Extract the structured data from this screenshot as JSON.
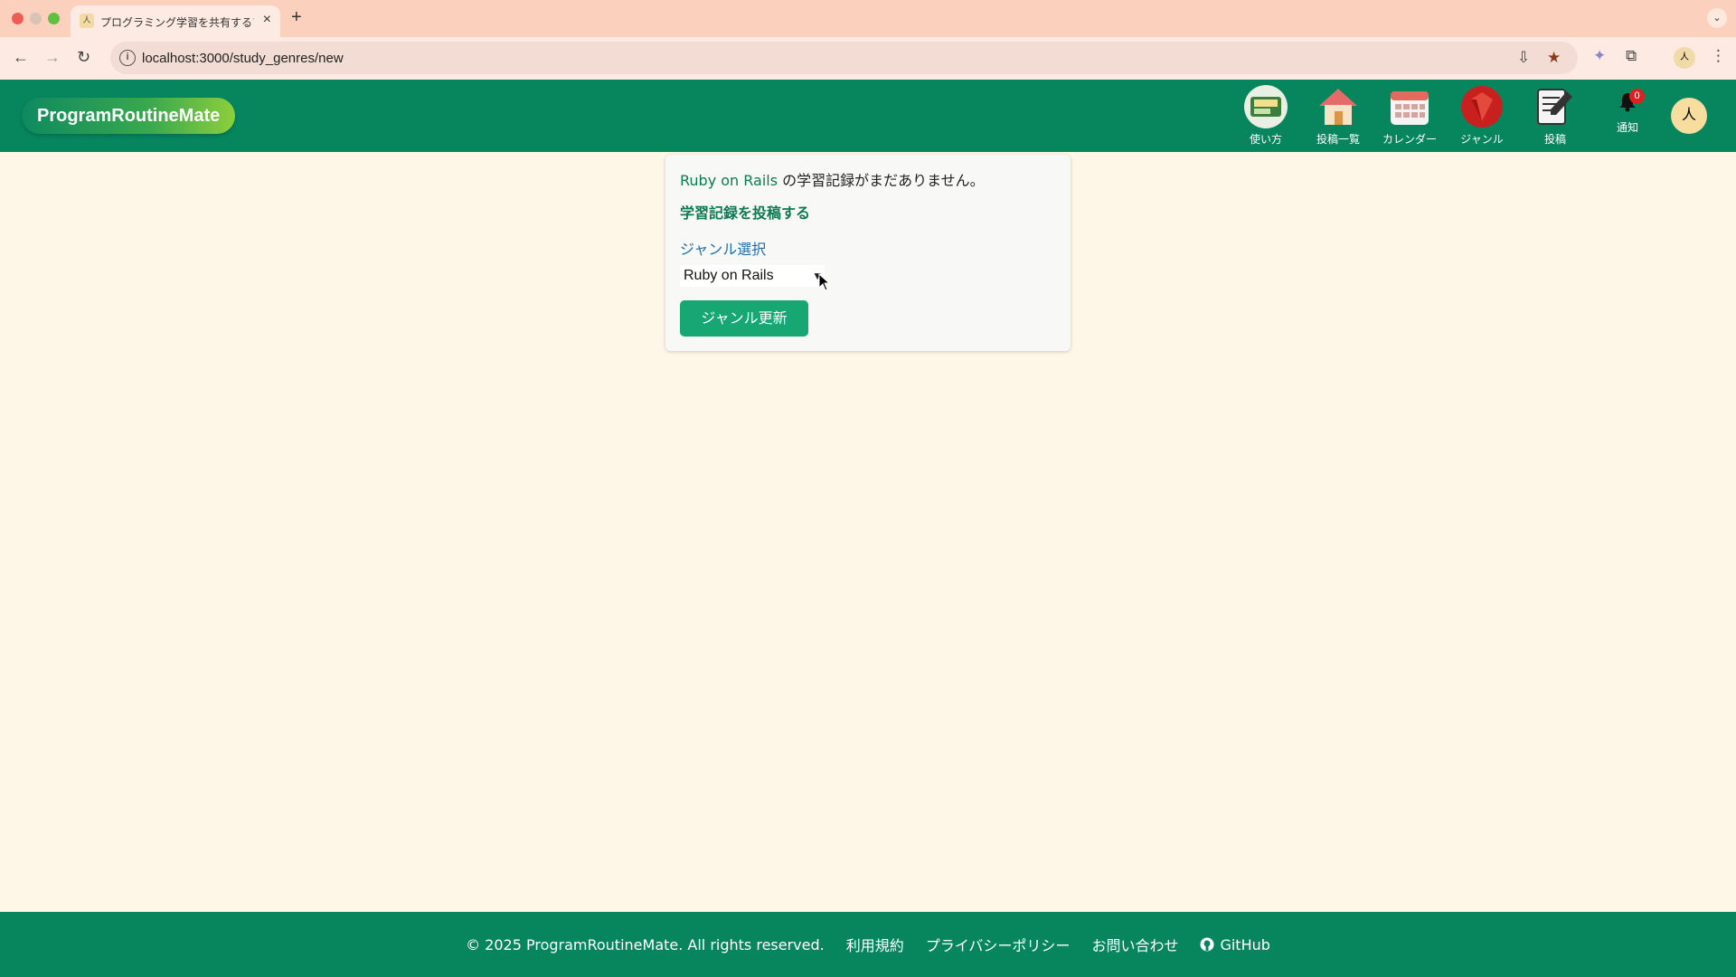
{
  "browser": {
    "tab_title": "プログラミング学習を共有するア",
    "url": "localhost:3000/study_genres/new"
  },
  "header": {
    "logo": "ProgramRoutineMate",
    "nav": [
      {
        "label": "使い方",
        "icon": "guide-book-icon"
      },
      {
        "label": "投稿一覧",
        "icon": "house-icon"
      },
      {
        "label": "カレンダー",
        "icon": "calendar-icon"
      },
      {
        "label": "ジャンル",
        "icon": "ruby-gem-icon"
      },
      {
        "label": "投稿",
        "icon": "edit-note-icon"
      }
    ],
    "notifications": {
      "label": "通知",
      "count": "0"
    }
  },
  "card": {
    "genre_name": "Ruby on Rails",
    "message_suffix": " の学習記録がまだありません。",
    "post_link": "学習記録を投稿する",
    "select_label": "ジャンル選択",
    "select_value": "Ruby on Rails",
    "update_button": "ジャンル更新"
  },
  "footer": {
    "copyright": "© 2025 ProgramRoutineMate. All rights reserved.",
    "terms": "利用規約",
    "privacy": "プライバシーポリシー",
    "contact": "お問い合わせ",
    "github": "GitHub"
  },
  "colors": {
    "header_bg": "#07865e",
    "page_bg": "#fef6e6",
    "button_bg": "#16a773",
    "link_green": "#0b7a55",
    "label_blue": "#1d6fb0"
  }
}
